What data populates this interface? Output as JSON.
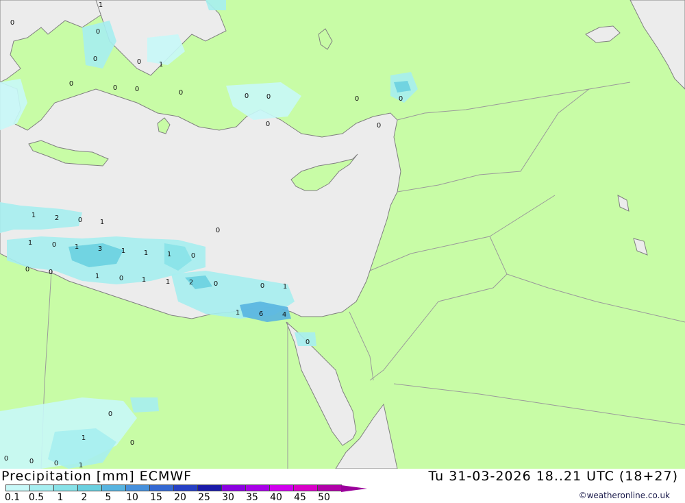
{
  "title": "Precipitation [mm] ECMWF",
  "datetime": "Tu 31-03-2026 18..21 UTC (18+27)",
  "credit": "©weatheronline.co.uk",
  "colors": {
    "land": "#c8fca6",
    "sea": "#ececec",
    "border": "#9a9a9a",
    "coast": "#808080"
  },
  "legend": {
    "ticks": [
      "0.1",
      "0.5",
      "1",
      "2",
      "5",
      "10",
      "15",
      "20",
      "25",
      "30",
      "35",
      "40",
      "45",
      "50"
    ],
    "colors": [
      "#c8f8f8",
      "#a6eef0",
      "#88e2e8",
      "#6ad0e0",
      "#58b4e0",
      "#4690dc",
      "#3468d2",
      "#2640c4",
      "#1a1aa8",
      "#8a00e0",
      "#a800e8",
      "#d000ee",
      "#d800c8",
      "#b000a8"
    ]
  },
  "values": [
    {
      "label": "1"
    },
    {
      "label": "0"
    },
    {
      "label": "0"
    },
    {
      "label": "0"
    },
    {
      "label": "1"
    },
    {
      "label": "0"
    },
    {
      "label": "0"
    },
    {
      "label": "0"
    },
    {
      "label": "0"
    },
    {
      "label": "0"
    },
    {
      "label": "0"
    },
    {
      "label": "0"
    },
    {
      "label": "0"
    },
    {
      "label": "0"
    },
    {
      "label": "0"
    },
    {
      "label": "0"
    },
    {
      "label": "1"
    },
    {
      "label": "2"
    },
    {
      "label": "0"
    },
    {
      "label": "1"
    },
    {
      "label": "0"
    },
    {
      "label": "1"
    },
    {
      "label": "0"
    },
    {
      "label": "1"
    },
    {
      "label": "3"
    },
    {
      "label": "1"
    },
    {
      "label": "1"
    },
    {
      "label": "1"
    },
    {
      "label": "0"
    },
    {
      "label": "0"
    },
    {
      "label": "0"
    },
    {
      "label": "1"
    },
    {
      "label": "0"
    },
    {
      "label": "1"
    },
    {
      "label": "1"
    },
    {
      "label": "2"
    },
    {
      "label": "0"
    },
    {
      "label": "0"
    },
    {
      "label": "1"
    },
    {
      "label": "1"
    },
    {
      "label": "6"
    },
    {
      "label": "4"
    },
    {
      "label": "0"
    },
    {
      "label": "0"
    },
    {
      "label": "1"
    },
    {
      "label": "0"
    },
    {
      "label": "0"
    },
    {
      "label": "0"
    },
    {
      "label": "0"
    },
    {
      "label": "1"
    }
  ]
}
